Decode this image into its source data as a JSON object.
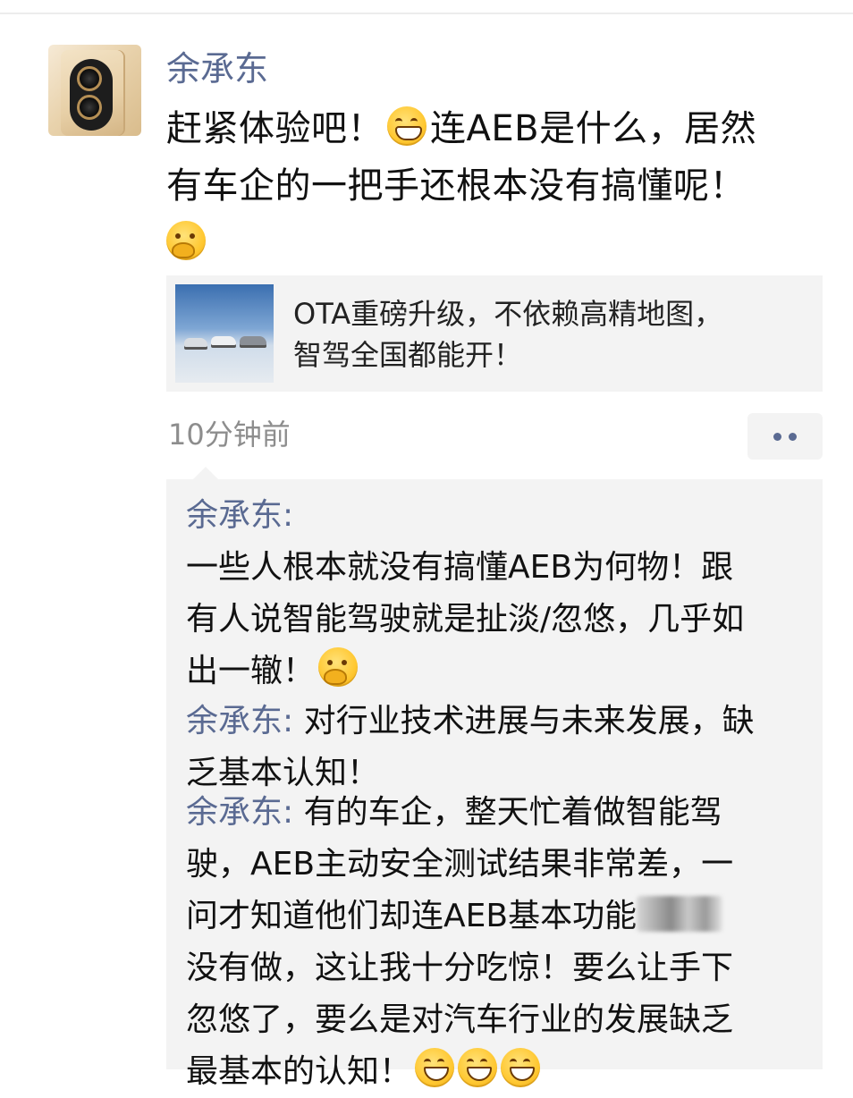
{
  "post": {
    "author": "余承东",
    "text_lines": [
      "赶紧体验吧！",
      "连AEB是什么，居然",
      "有车企的一把手还根本没有搞懂呢！"
    ],
    "emojis": [
      "grin-emoji",
      "thinking-emoji"
    ],
    "time": "10分钟前"
  },
  "link_card": {
    "title_line1": "OTA重磅升级，不依赖高精地图，",
    "title_line2": "智驾全国都能开！"
  },
  "comments": [
    {
      "author": "余承东:",
      "lines": [
        "一些人根本就没有搞懂AEB为何物！跟",
        "有人说智能驾驶就是扯淡/忽悠，几乎如",
        "出一辙！"
      ]
    },
    {
      "author": "余承东:",
      "lines": [
        " 对行业技术进展与未来发展，缺",
        "乏基本认知！"
      ]
    },
    {
      "author": "余承东:",
      "lines": [
        " 有的车企，整天忙着做智能驾",
        "驶，AEB主动安全测试结果非常差，一",
        "问才知道他们却连AEB基本功能",
        "没有做，这让我十分吃惊！要么让手下",
        "忽悠了，要么是对汽车行业的发展缺乏",
        "最基本的认知！"
      ]
    }
  ],
  "icons": {
    "avatar": "phone-avatar",
    "more": "more-dots-icon"
  },
  "colors": {
    "name_blue": "#5a6a92",
    "time_gray": "#8d8d8d",
    "card_bg": "#f3f3f3"
  }
}
